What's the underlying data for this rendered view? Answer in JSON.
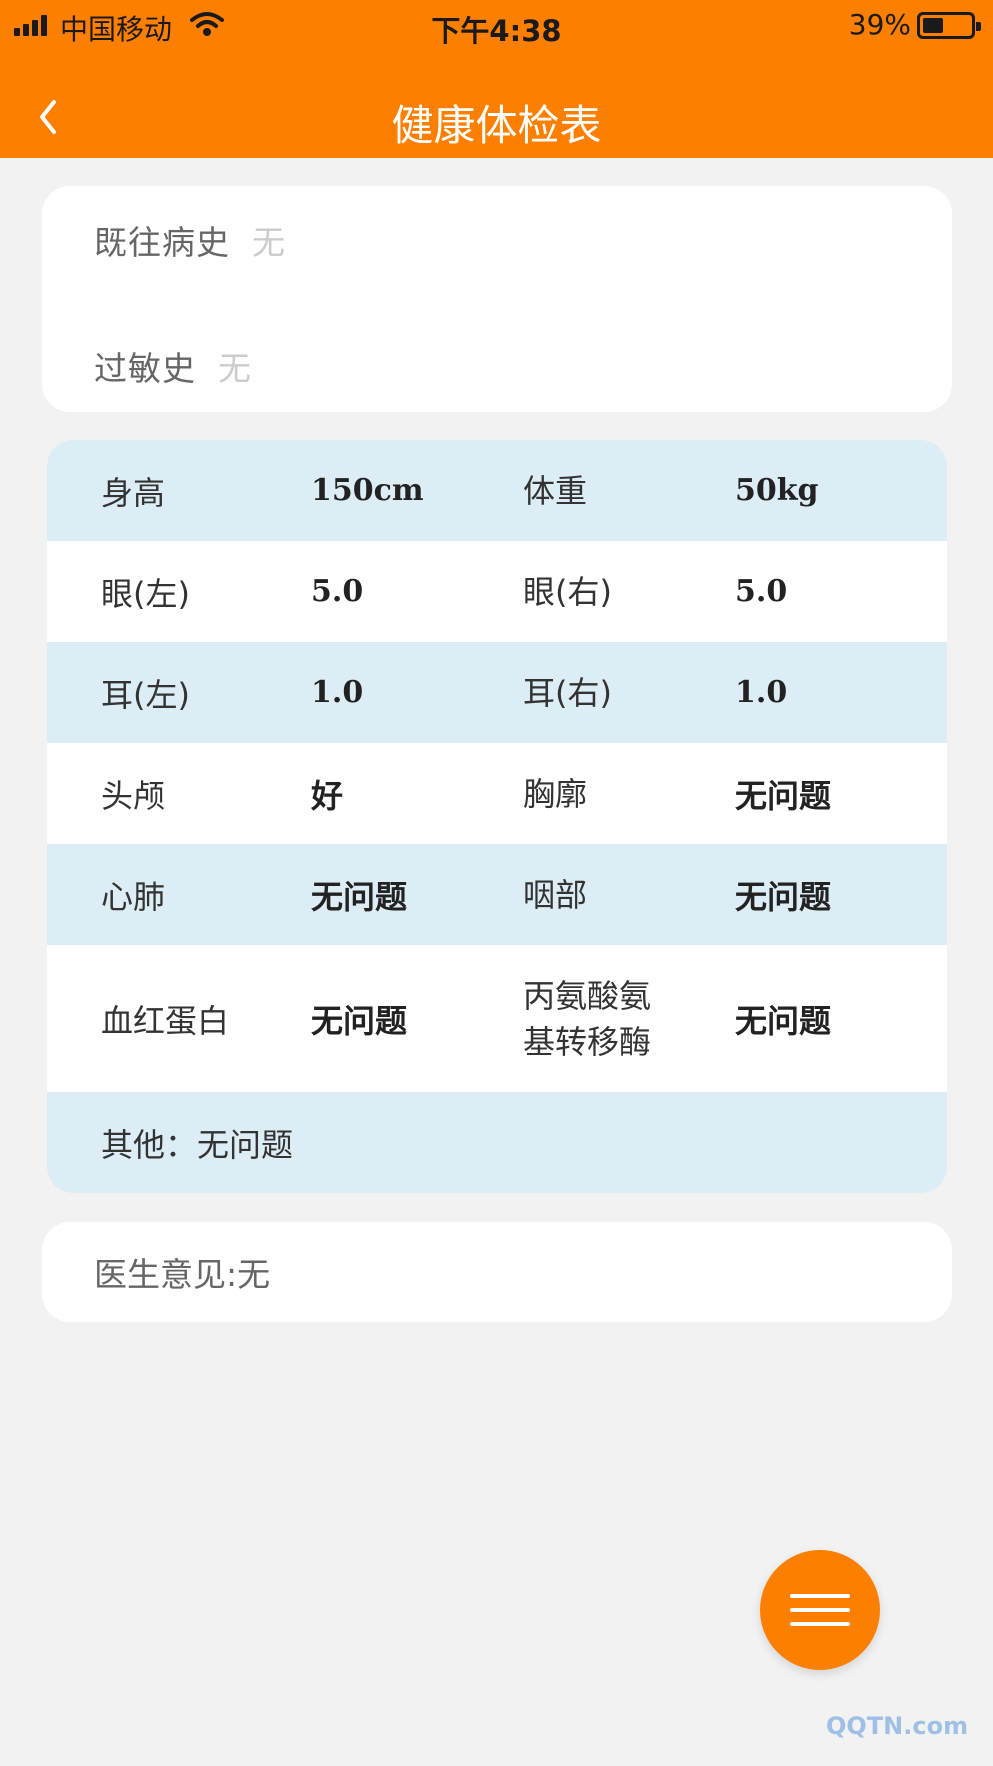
{
  "status_bar": {
    "carrier": "中国移动",
    "time": "下午4:38",
    "battery": "39%"
  },
  "nav": {
    "title": "健康体检表",
    "back_icon": "chevron-left-icon"
  },
  "history": {
    "past_label": "既往病史",
    "past_value": "无",
    "allergy_label": "过敏史",
    "allergy_value": "无"
  },
  "exam": {
    "rows": [
      {
        "l1": "身高",
        "v1": "150cm",
        "l2": "体重",
        "v2": "50kg"
      },
      {
        "l1": "眼(左)",
        "v1": "5.0",
        "l2": "眼(右)",
        "v2": "5.0"
      },
      {
        "l1": "耳(左)",
        "v1": "1.0",
        "l2": "耳(右)",
        "v2": "1.0"
      },
      {
        "l1": "头颅",
        "v1": "好",
        "l2": "胸廓",
        "v2": "无问题"
      },
      {
        "l1": "心肺",
        "v1": "无问题",
        "l2": "咽部",
        "v2": "无问题"
      },
      {
        "l1": "血红蛋白",
        "v1": "无问题",
        "l2a": "丙氨酸氨",
        "l2b": "基转移酶",
        "v2": "无问题"
      }
    ],
    "other": "其他：无问题"
  },
  "doctor": {
    "text": "医生意见:无"
  },
  "fab": {
    "icon": "menu-icon"
  },
  "watermark": "QQTN.com"
}
